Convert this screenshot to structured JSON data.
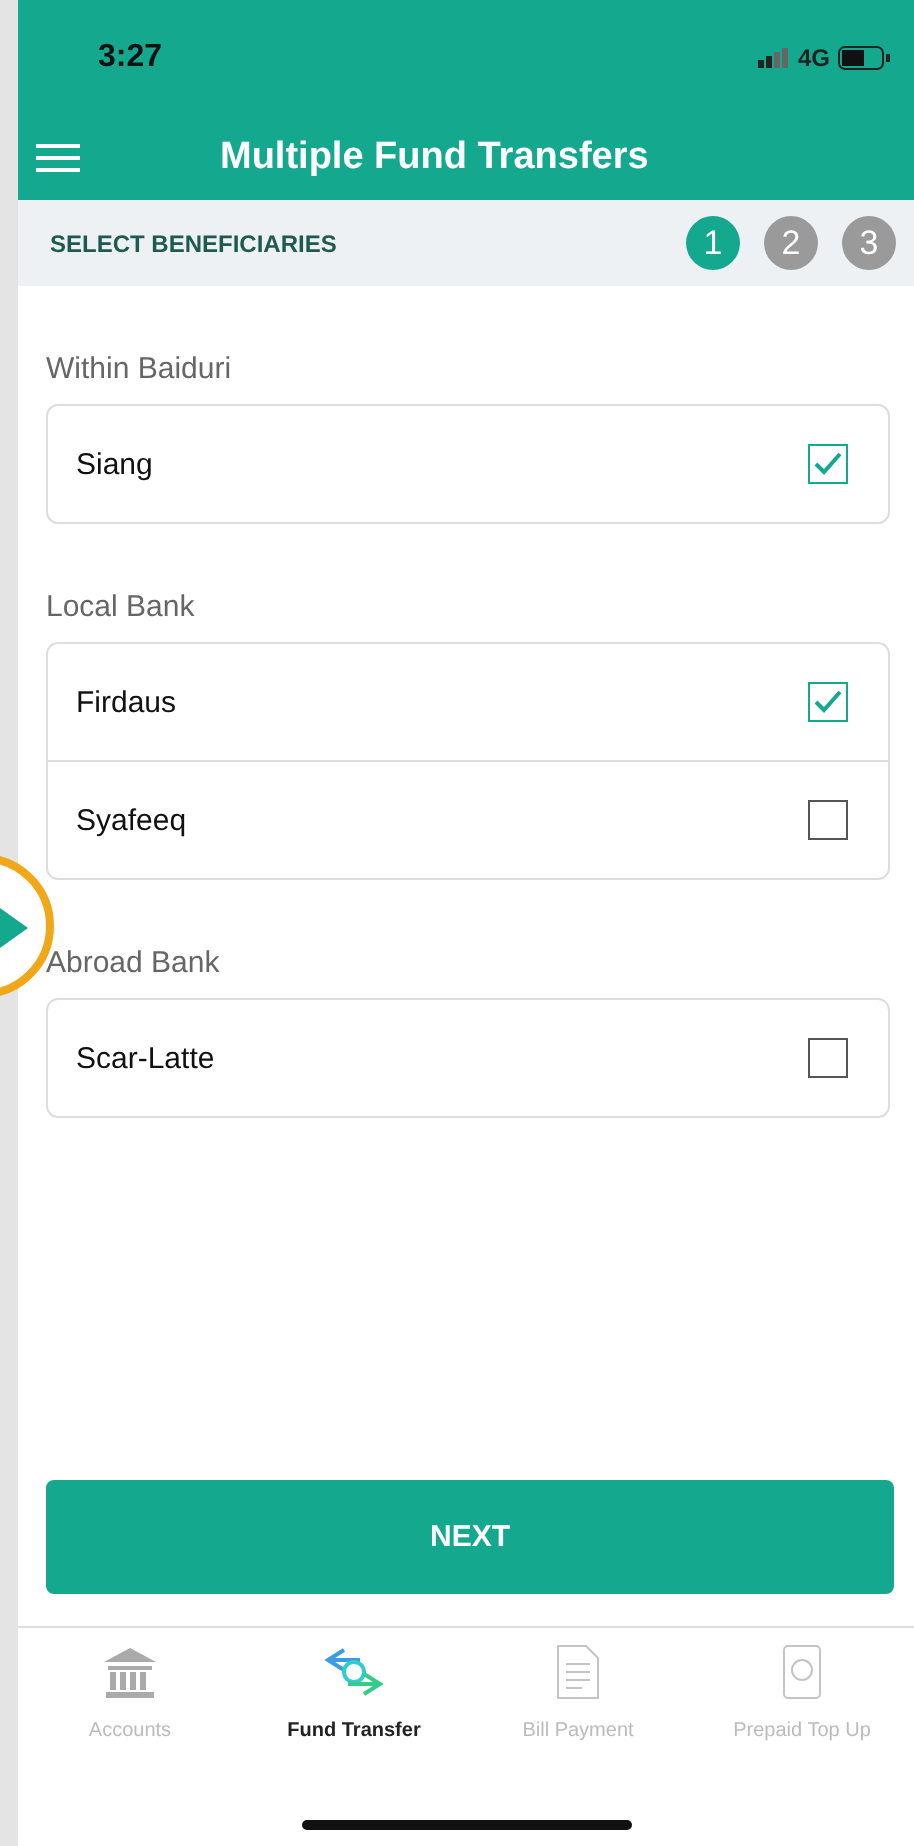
{
  "status_bar": {
    "time": "3:27",
    "network": "4G"
  },
  "header": {
    "title": "Multiple Fund Transfers"
  },
  "steps": {
    "label": "SELECT BENEFICIARIES",
    "items": [
      {
        "label": "1",
        "selected": true
      },
      {
        "label": "2",
        "selected": false
      },
      {
        "label": "3",
        "selected": false
      }
    ]
  },
  "groups": [
    {
      "title": "Within Baiduri",
      "beneficiaries": [
        {
          "name": "Siang",
          "checked": true
        }
      ]
    },
    {
      "title": "Local Bank",
      "beneficiaries": [
        {
          "name": "Firdaus",
          "checked": true
        },
        {
          "name": "Syafeeq",
          "checked": false
        }
      ]
    },
    {
      "title": "Abroad Bank",
      "beneficiaries": [
        {
          "name": "Scar-Latte",
          "checked": false
        }
      ]
    }
  ],
  "next_button": "NEXT",
  "tabs": [
    {
      "label": "Accounts",
      "kind": "bank",
      "selected": false
    },
    {
      "label": "Fund Transfer",
      "kind": "transfer",
      "selected": true
    },
    {
      "label": "Bill Payment",
      "kind": "bill",
      "selected": false
    },
    {
      "label": "Prepaid Top Up",
      "kind": "phone",
      "selected": false
    }
  ]
}
